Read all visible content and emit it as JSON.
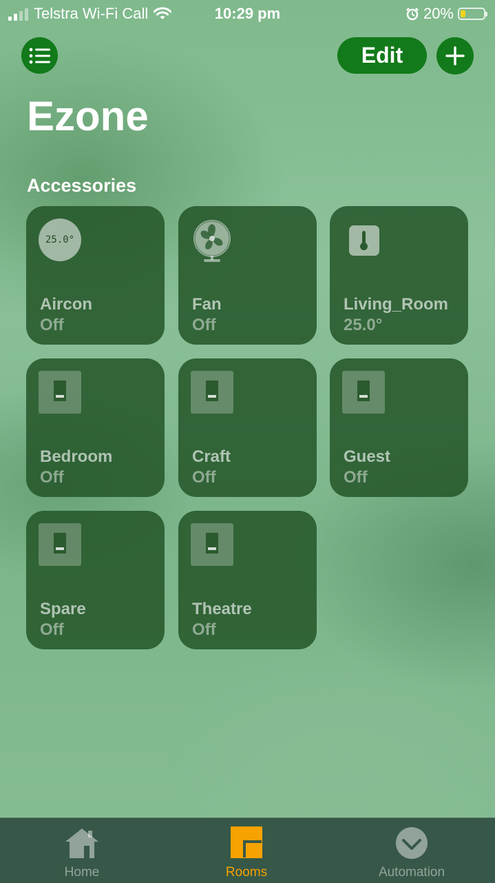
{
  "status_bar": {
    "carrier": "Telstra Wi-Fi Call",
    "time": "10:29 pm",
    "battery_percent": "20%",
    "battery_level": 0.2,
    "icons": [
      "signal-icon",
      "wifi-icon",
      "alarm-icon",
      "battery-icon"
    ]
  },
  "header": {
    "edit_label": "Edit",
    "title": "Ezone"
  },
  "section_title": "Accessories",
  "accessories": [
    {
      "name": "Aircon",
      "state": "Off",
      "icon": "thermostat-icon",
      "icon_text": "25.0°"
    },
    {
      "name": "Fan",
      "state": "Off",
      "icon": "fan-icon"
    },
    {
      "name": "Living_Room",
      "state": "25.0°",
      "icon": "temperature-sensor-icon"
    },
    {
      "name": "Bedroom",
      "state": "Off",
      "icon": "switch-icon"
    },
    {
      "name": "Craft",
      "state": "Off",
      "icon": "switch-icon"
    },
    {
      "name": "Guest",
      "state": "Off",
      "icon": "switch-icon"
    },
    {
      "name": "Spare",
      "state": "Off",
      "icon": "switch-icon"
    },
    {
      "name": "Theatre",
      "state": "Off",
      "icon": "switch-icon"
    }
  ],
  "tabs": [
    {
      "label": "Home",
      "icon": "house-icon",
      "active": false
    },
    {
      "label": "Rooms",
      "icon": "rooms-icon",
      "active": true
    },
    {
      "label": "Automation",
      "icon": "automation-icon",
      "active": false
    }
  ],
  "colors": {
    "accent_green": "#127a1a",
    "tab_active": "#f6a200",
    "battery_fill": "#f5d319"
  }
}
